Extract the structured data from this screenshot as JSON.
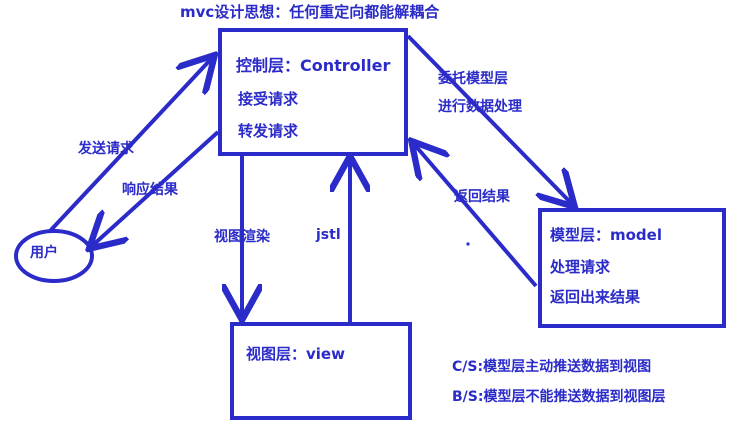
{
  "title": "mvc设计思想：任何重定向都能解耦合",
  "controller": {
    "title": "控制层：Controller",
    "line1": "接受请求",
    "line2": "转发请求"
  },
  "model": {
    "title": "模型层：model",
    "line1": "处理请求",
    "line2": "返回出来结果"
  },
  "view": {
    "title": "视图层：view"
  },
  "user": {
    "label": "用户"
  },
  "arrows": {
    "send_request": "发送请求",
    "response": "响应结果",
    "render": "视图渲染",
    "jstl": "jstl",
    "delegate_line1": "委托模型层",
    "delegate_line2": "进行数据处理",
    "return_result": "返回结果"
  },
  "notes": {
    "cs": "C/S:模型层主动推送数据到视图",
    "bs": "B/S:模型层不能推送数据到视图层"
  },
  "colors": {
    "stroke": "#2b2bc9"
  }
}
